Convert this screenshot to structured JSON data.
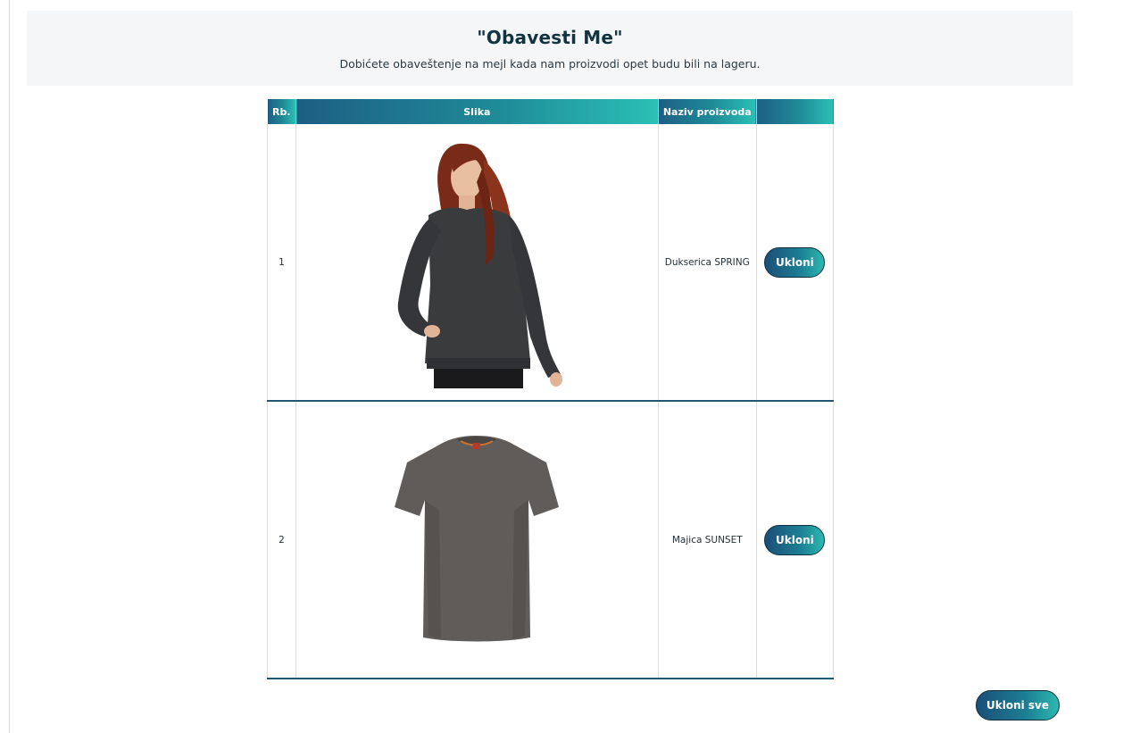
{
  "header": {
    "title": "\"Obavesti Me\"",
    "subtitle": "Dobićete obaveštenje na mejl kada nam proizvodi opet budu bili na lageru."
  },
  "table": {
    "columns": [
      "Rb.",
      "Slika",
      "Naziv proizvoda",
      ""
    ],
    "rows": [
      {
        "rb": "1",
        "image_icon": "sweatshirt-photo",
        "name": "Dukserica SPRING",
        "action": "Ukloni"
      },
      {
        "rb": "2",
        "image_icon": "tshirt-photo",
        "name": "Majica SUNSET",
        "action": "Ukloni"
      }
    ]
  },
  "actions": {
    "remove_all": "Ukloni sve"
  },
  "colors": {
    "accent_start": "#1a4f78",
    "accent_end": "#2cb8b1",
    "header_band": "#f5f6f8",
    "row_divider": "#1e5872"
  }
}
